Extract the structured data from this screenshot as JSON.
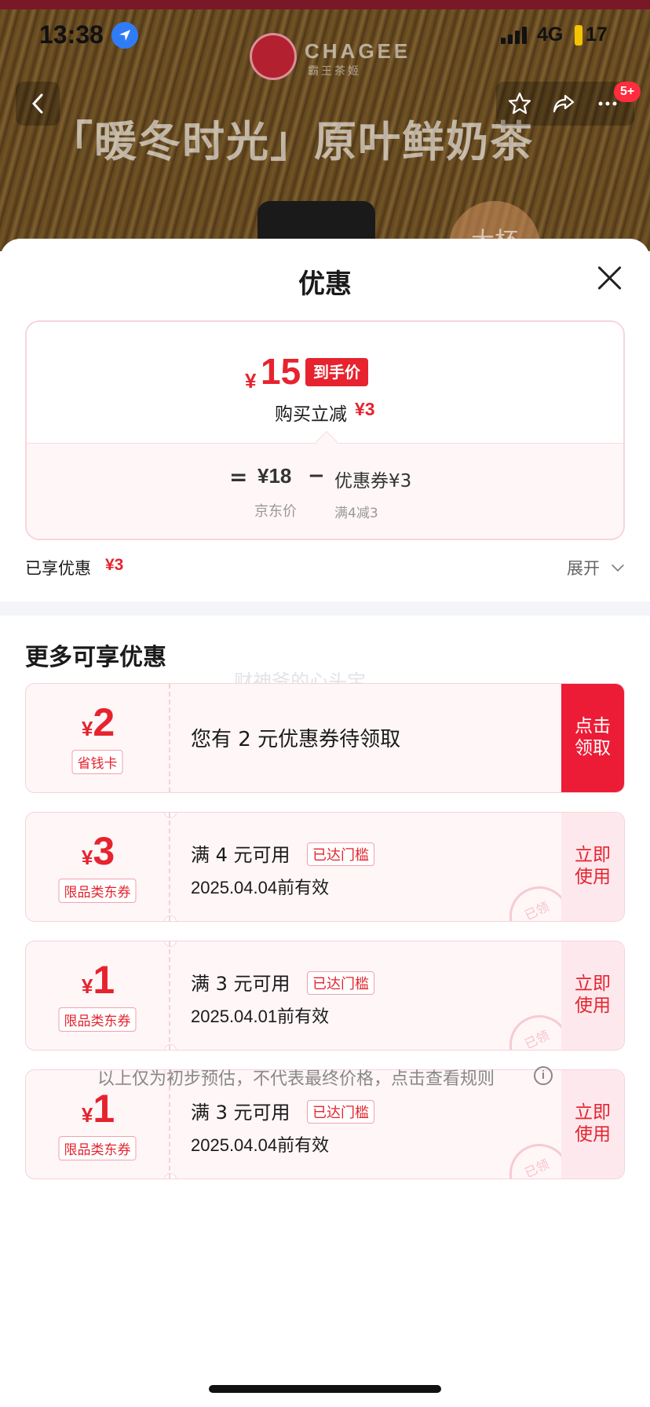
{
  "status_bar": {
    "time": "13:38",
    "network": "4G",
    "battery": "17"
  },
  "header": {
    "brand_name": "CHAGEE",
    "brand_sub": "霸王茶姬",
    "hero_title": "「暖冬时光」原叶鲜奶茶",
    "size_badge": "大杯",
    "notification_badge": "5+"
  },
  "sheet": {
    "title": "优惠"
  },
  "price_card": {
    "final_symbol": "¥",
    "final_price": "15",
    "final_tag": "到手价",
    "instant_label": "购买立减",
    "instant_amount": "¥3",
    "equals": "=",
    "jd_price": "¥18",
    "jd_price_label": "京东价",
    "minus": "−",
    "coupon_part": "优惠券¥3",
    "coupon_condition": "满4减3"
  },
  "summary": {
    "enjoyed_label": "已享优惠",
    "enjoyed_amount": "¥3",
    "expand_label": "展开"
  },
  "more": {
    "title": "更多可享优惠",
    "watermark": "财神爷的心头宝",
    "coupons": [
      {
        "symbol": "¥",
        "value": "2",
        "tag": "省钱卡",
        "text": "您有 2 元优惠券待领取",
        "button": "点击\n领取"
      },
      {
        "symbol": "¥",
        "value": "3",
        "tag": "限品类东券",
        "condition": "满 4 元可用",
        "badge": "已达门槛",
        "expiry": "2025.04.04前有效",
        "button": "立即\n使用",
        "stamp": "已领"
      },
      {
        "symbol": "¥",
        "value": "1",
        "tag": "限品类东券",
        "condition": "满 3 元可用",
        "badge": "已达门槛",
        "expiry": "2025.04.01前有效",
        "button": "立即\n使用",
        "stamp": "已领"
      },
      {
        "symbol": "¥",
        "value": "1",
        "tag": "限品类东券",
        "condition": "满 3 元可用",
        "badge": "已达门槛",
        "expiry": "2025.04.04前有效",
        "button": "立即\n使用",
        "stamp": "已领"
      }
    ]
  },
  "disclaimer": "以上仅为初步预估，不代表最终价格，点击查看规则",
  "colors": {
    "accent": "#e6232e",
    "claim_button": "#ed1c36",
    "coupon_bg": "#fff6f7"
  }
}
